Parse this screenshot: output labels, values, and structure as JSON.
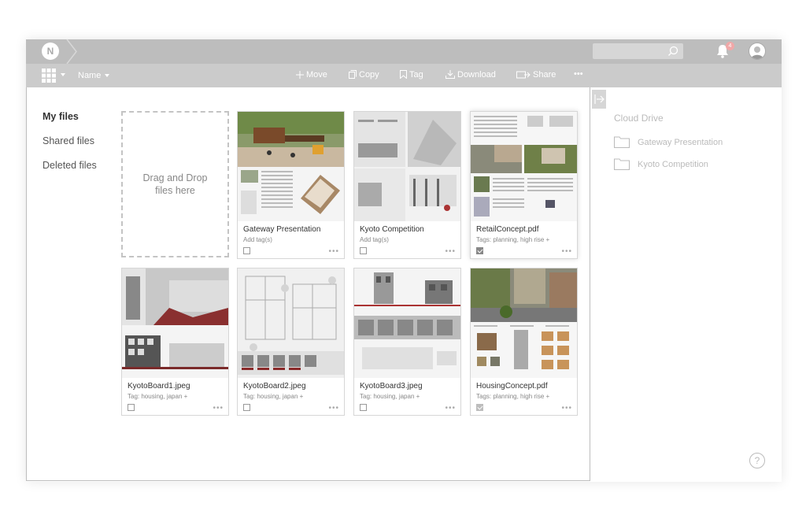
{
  "topbar": {
    "logo": "N",
    "notification_count": "4"
  },
  "toolbar": {
    "sort_label": "Name",
    "move": "Move",
    "copy": "Copy",
    "tag": "Tag",
    "download": "Download",
    "share": "Share",
    "more": "•••"
  },
  "nav": {
    "my_files": "My files",
    "shared_files": "Shared files",
    "deleted_files": "Deleted files"
  },
  "dropzone": {
    "text": "Drag and Drop files here"
  },
  "files": [
    {
      "name": "Gateway Presentation",
      "tags": "Add tag(s)",
      "checked": false
    },
    {
      "name": "Kyoto Competition",
      "tags": "Add tag(s)",
      "checked": false
    },
    {
      "name": "RetailConcept.pdf",
      "tags": "Tags: planning, high rise +",
      "checked": true
    },
    {
      "name": "KyotoBoard1.jpeg",
      "tags": "Tag: housing, japan +",
      "checked": false
    },
    {
      "name": "KyotoBoard2.jpeg",
      "tags": "Tag: housing, japan +",
      "checked": false
    },
    {
      "name": "KyotoBoard3.jpeg",
      "tags": "Tag: housing, japan +",
      "checked": false
    },
    {
      "name": "HousingConcept.pdf",
      "tags": "Tags: planning, high rise +",
      "checked": true
    }
  ],
  "card_more": "•••",
  "cloud": {
    "title": "Cloud Drive",
    "folders": [
      "Gateway Presentation",
      "Kyoto Competition"
    ]
  },
  "help": "?",
  "colors": {
    "topbar": "#bdbdbd",
    "toolbar": "#cbcbcb",
    "accent_badge": "#f0a8a8"
  }
}
